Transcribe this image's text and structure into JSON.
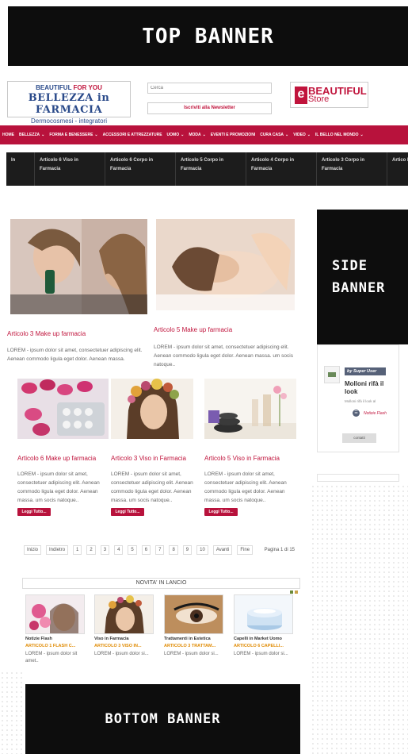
{
  "banners": {
    "top": "TOP BANNER",
    "side_line1": "SIDE",
    "side_line2": "BANNER",
    "bottom": "BOTTOM BANNER"
  },
  "header": {
    "logo": {
      "line1_a": "BEAUTIFUL",
      "line1_b": "FOR YOU",
      "line2": "BELLEZZA in FARMACIA",
      "line3": "Dermocosmesi - integratori"
    },
    "search_placeholder": "Cerca",
    "newsletter_label": "Iscriviti alla Newsletter",
    "store_logo": {
      "e": "e",
      "beautiful": "BEAUTIFUL",
      "store": "Store"
    }
  },
  "nav": {
    "items": [
      {
        "label": "Home",
        "dropdown": false
      },
      {
        "label": "Bellezza",
        "dropdown": true
      },
      {
        "label": "Forma e Benessere",
        "dropdown": true
      },
      {
        "label": "Accessori e Attrezzature",
        "dropdown": false
      },
      {
        "label": "Uomo",
        "dropdown": true
      },
      {
        "label": "Moda",
        "dropdown": true
      },
      {
        "label": "Eventi e Promozioni",
        "dropdown": false
      },
      {
        "label": "Cura Casa",
        "dropdown": true
      },
      {
        "label": "Video",
        "dropdown": true
      },
      {
        "label": "Il Bello nel Mondo",
        "dropdown": true
      }
    ]
  },
  "strip": {
    "items": [
      "In",
      "Articolo 6 Viso in Farmacia",
      "Articolo 6 Corpo in Farmacia",
      "Articolo 5 Corpo in Farmacia",
      "Articolo 4 Corpo in Farmacia",
      "Articolo 3 Corpo in Farmacia",
      "Artico Farm"
    ]
  },
  "articles": {
    "lorem": "LOREM - ipsum dolor sit amet, consectetuer adipiscing elit. Aenean commodo ligula eget dolor. Aenean massa. um socis natoque..",
    "read_more": "Leggi Tutto...",
    "big": [
      {
        "title": "Articolo 3 Make up farmacia",
        "text": "LOREM - ipsum dolor sit amet, consectetuer adipiscing elit. Aenean commodo ligula eget dolor. Aenean massa."
      },
      {
        "title": "Articolo 5 Make up farmacia",
        "text": "LOREM - ipsum dolor sit amet, consectetuer adipiscing elit. Aenean commodo ligula eget dolor. Aenean massa. um socis natoque.."
      }
    ],
    "small": [
      {
        "title": "Articolo 6 Make up farmacia",
        "text": "LOREM - ipsum dolor sit amet, consectetuer adipiscing elit. Aenean commodo ligula eget dolor. Aenean massa. um socis natoque.."
      },
      {
        "title": "Articolo 3 Viso in Farmacia",
        "text": "LOREM - ipsum dolor sit amet, consectetuer adipiscing elit. Aenean commodo ligula eget dolor. Aenean massa. um socis natoque.."
      },
      {
        "title": "Articolo 5 Viso in Farmacia",
        "text": "LOREM - ipsum dolor sit amet, consectetuer adipiscing elit. Aenean commodo ligula eget dolor. Aenean massa. um socis natoque.."
      }
    ]
  },
  "side_panel": {
    "author": "by Super User",
    "title": "Molloni rifà il look",
    "meta": "Molloni rifà il look al",
    "tag": "Notizie Flash",
    "button": "contatti"
  },
  "pager": {
    "items": [
      "Inizio",
      "Indietro",
      "1",
      "2",
      "3",
      "4",
      "5",
      "6",
      "7",
      "8",
      "9",
      "10",
      "Avanti",
      "Fine"
    ],
    "info": "Pagina 1 di 15"
  },
  "novita": {
    "heading": "NOVITA' IN LANCIO",
    "items": [
      {
        "category": "Notizie Flash",
        "title": "ARTICOLO 1 FLASH C...",
        "text": "LOREM - ipsum dolor sit amet..",
        "img": "flowers"
      },
      {
        "category": "Viso in Farmacia",
        "title": "ARTICOLO 3 VISO IN...",
        "text": "LOREM - ipsum dolor si...",
        "img": "flower-crown"
      },
      {
        "category": "Trattamenti in Estetica",
        "title": "ARTICOLO 3 TRATTAM...",
        "text": "LOREM - ipsum dolor si...",
        "img": "eye-makeup"
      },
      {
        "category": "Capelli in Market Uomo",
        "title": "ARTICOLO 6 CAPELLI...",
        "text": "LOREM - ipsum dolor si...",
        "img": "cream-jar"
      }
    ]
  },
  "colors": {
    "brand_red": "#b8123c",
    "dark": "#1c1c1c",
    "orange": "#e08a00"
  }
}
